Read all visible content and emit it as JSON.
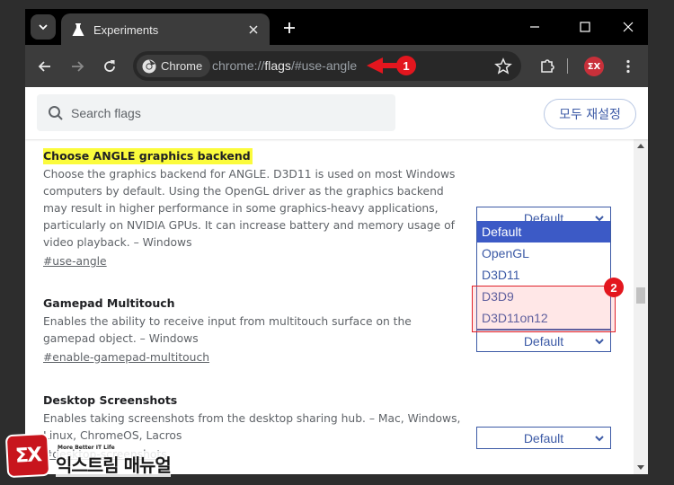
{
  "browser": {
    "tab": {
      "title": "Experiments",
      "icon": "flask-icon"
    },
    "omnibox": {
      "chip_label": "Chrome",
      "url_prefix": "chrome://",
      "url_host": "flags",
      "url_rest": "/#use-angle"
    },
    "profile_badge": "ΣX"
  },
  "search": {
    "placeholder": "Search flags",
    "reset_all_label": "모두 재설정"
  },
  "flags": [
    {
      "title": "Choose ANGLE graphics backend",
      "highlighted": true,
      "description": "Choose the graphics backend for ANGLE. D3D11 is used on most Windows computers by default. Using the OpenGL driver as the graphics backend may result in higher performance in some graphics-heavy applications, particularly on NVIDIA GPUs. It can increase battery and memory usage of video playback. – Windows",
      "link": "#use-angle",
      "select_value": "Default",
      "options": [
        "Default",
        "OpenGL",
        "D3D11",
        "D3D9",
        "D3D11on12"
      ],
      "selected_option": "Default"
    },
    {
      "title": "Gamepad Multitouch",
      "description": "Enables the ability to receive input from multitouch surface on the gamepad object. – Windows",
      "link": "#enable-gamepad-multitouch",
      "select_value": "Default"
    },
    {
      "title": "Desktop Screenshots",
      "description": "Enables taking screenshots from the desktop sharing hub. – Mac, Windows, Linux, ChromeOS, Lacros",
      "link": "#desktop-screenshots",
      "link_visible_suffix": "hots",
      "select_value": "Default"
    }
  ],
  "annotations": {
    "badge1": "1",
    "badge2": "2",
    "color": "#e3161e"
  },
  "watermark": {
    "logo": "ΣX",
    "tagline": "More Better IT Life",
    "name": "익스트림 매뉴얼"
  },
  "colors": {
    "accent": "#3c5aa6",
    "highlight": "#fbfb3c",
    "selected_option_bg": "#3c5ac6"
  }
}
